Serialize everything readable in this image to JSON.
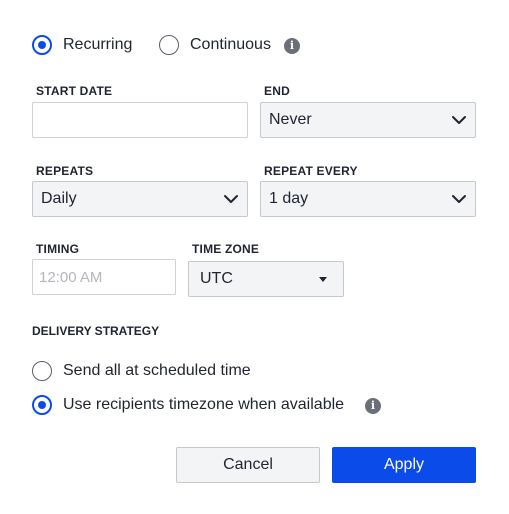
{
  "schedule_type": {
    "options": [
      {
        "label": "Recurring",
        "checked": true
      },
      {
        "label": "Continuous",
        "checked": false
      }
    ],
    "info_icon": "info-icon"
  },
  "start_date": {
    "label": "START DATE",
    "value": "",
    "placeholder": ""
  },
  "end": {
    "label": "END",
    "selected": "Never"
  },
  "repeats": {
    "label": "REPEATS",
    "selected": "Daily"
  },
  "repeat_every": {
    "label": "REPEAT EVERY",
    "selected": "1 day"
  },
  "timing": {
    "label": "TIMING",
    "placeholder": "12:00 AM"
  },
  "time_zone": {
    "label": "TIME ZONE",
    "selected": "UTC"
  },
  "delivery_strategy": {
    "label": "DELIVERY STRATEGY",
    "options": [
      {
        "label": "Send all at scheduled time",
        "checked": false
      },
      {
        "label": "Use recipients timezone when available",
        "checked": true
      }
    ]
  },
  "actions": {
    "cancel_label": "Cancel",
    "apply_label": "Apply"
  },
  "colors": {
    "accent": "#0a4bea",
    "select_bg": "#f3f4f6",
    "border": "#c5c8cf"
  }
}
